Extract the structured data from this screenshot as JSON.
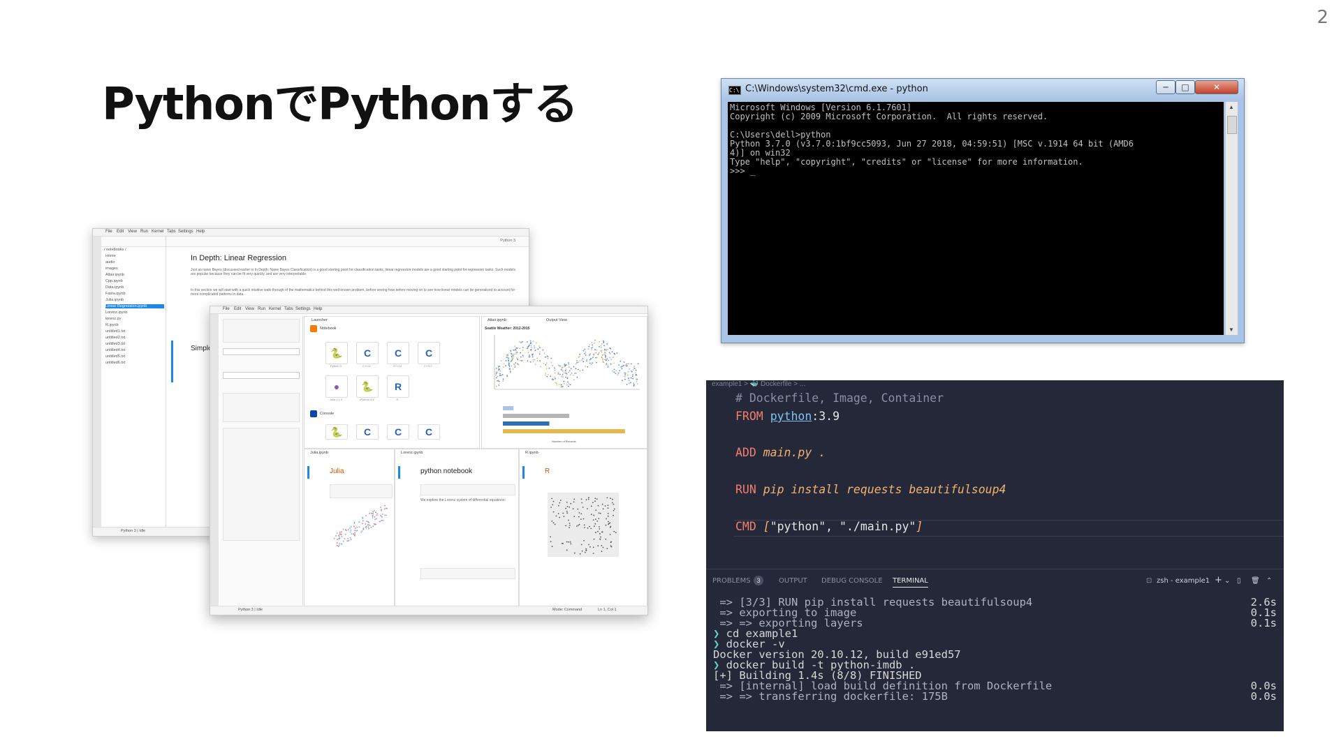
{
  "slide": {
    "page_number": "2",
    "title": "PythonでPythonする"
  },
  "cmd_window": {
    "title": "C:\\Windows\\system32\\cmd.exe - python",
    "icon": "cmd-icon",
    "buttons": [
      "─",
      "□",
      "✕"
    ],
    "lines": [
      "Microsoft Windows [Version 6.1.7601]",
      "Copyright (c) 2009 Microsoft Corporation.  All rights reserved.",
      "",
      "C:\\Users\\dell>python",
      "Python 3.7.0 (v3.7.0:1bf9cc5093, Jun 27 2018, 04:59:51) [MSC v.1914 64 bit (AMD6",
      "4)] on win32",
      "Type \"help\", \"copyright\", \"credits\" or \"license\" for more information.",
      ">>> _"
    ]
  },
  "jupyter_back": {
    "menu": [
      "File",
      "Edit",
      "View",
      "Run",
      "Kernel",
      "Tabs",
      "Settings",
      "Help"
    ],
    "path": "/ notebooks /",
    "files": [
      "Home",
      "audio",
      "images",
      "Altair.ipynb",
      "Cpp.ipynb",
      "Data.ipynb",
      "Fasta.ipynb",
      "Julia.ipynb",
      "Linear Regression.ipynb",
      "Lorenz.ipynb",
      "lorenz.py",
      "R.ipynb",
      "untitled1.txt",
      "untitled2.txt",
      "untitled3.txt",
      "untitled4.txt",
      "untitled5.txt",
      "untitled6.txt"
    ],
    "kernel": "Python 3",
    "heading": "In Depth: Linear Regression",
    "paragraph1": "Just as naive Bayes (discussed earlier in In Depth: Naive Bayes Classification) is a good starting point for classification tasks, linear regression models are a good starting point for regression tasks. Such models are popular because they can be fit very quickly, and are very interpretable.",
    "paragraph2": "In this section we will start with a quick intuitive walk-through of the mathematics behind this well-known problem, before seeing how before moving on to see how linear models can be generalized to account for more complicated patterns in data.",
    "subheading": "Simple",
    "status": "Python 3 | Idle"
  },
  "jupyter_front": {
    "menu": [
      "File",
      "Edit",
      "View",
      "Run",
      "Kernel",
      "Tabs",
      "Settings",
      "Help"
    ],
    "launcher_tab": "Launcher",
    "notebook_label": "Notebook",
    "console_label": "Console",
    "kernels": [
      {
        "glyph": "🐍",
        "label": "Python 3",
        "color": "#3572a5"
      },
      {
        "glyph": "C",
        "label": "C++11",
        "color": "#2b5fb3"
      },
      {
        "glyph": "C",
        "label": "C++14",
        "color": "#2b5fb3"
      },
      {
        "glyph": "C",
        "label": "C++17",
        "color": "#2b5fb3"
      },
      {
        "glyph": "●",
        "label": "Julia 1.1.0",
        "color": "#9558b2"
      },
      {
        "glyph": "🐍",
        "label": "xPython 3.6",
        "color": "#3572a5"
      },
      {
        "glyph": "R",
        "label": "R",
        "color": "#2165b6"
      }
    ],
    "altair_tab": "Altair.ipynb",
    "output_tab": "Output View",
    "chart_title": "Seattle Weather: 2012-2015",
    "bar_axis_label": "Number of Records",
    "bar_colors": [
      "#a9c4e8",
      "#b5b5b5",
      "#2e6fb3",
      "#e6b94a"
    ],
    "bar_values": [
      0.08,
      0.5,
      0.35,
      0.92
    ],
    "julia_tab": "Julia.ipynb",
    "lorenz_tab": "Lorenz.ipynb",
    "r_tab": "R.ipynb",
    "julia_heading": "Julia",
    "python_heading": "python notebook",
    "r_heading": "R",
    "lorenz_text": "We explore the Lorenz system of differential equations:",
    "status": "Python 3 | Idle",
    "mode": "Mode: Command",
    "cursor": "Ln 1, Col 1"
  },
  "vscode": {
    "breadcrumb": "example1 > 🐳 Dockerfile > ...",
    "editor": {
      "comment": "# Dockerfile, Image, Container",
      "from_kw": "FROM",
      "from_image": "python",
      "from_tag": ":3.9",
      "add_kw": "ADD",
      "add_args": "main.py .",
      "run_kw": "RUN",
      "run_args": "pip install requests beautifulsoup4",
      "cmd_kw": "CMD",
      "cmd_open": "[",
      "cmd_arg1": "\"python\"",
      "cmd_sep": ", ",
      "cmd_arg2": "\"./main.py\"",
      "cmd_close": "]"
    },
    "panel_tabs": {
      "problems": "PROBLEMS",
      "problems_count": "3",
      "output": "OUTPUT",
      "debug": "DEBUG CONSOLE",
      "terminal": "TERMINAL",
      "shell": "zsh - example1"
    },
    "terminal": [
      {
        "text": " => [3/3] RUN pip install requests beautifulsoup4",
        "time": "2.6s"
      },
      {
        "text": " => exporting to image",
        "time": "0.1s"
      },
      {
        "text": " => => exporting layers",
        "time": "0.1s"
      },
      {
        "prompt": "❯",
        "text": " cd example1",
        "time": ""
      },
      {
        "prompt": "❯",
        "text": " docker -v",
        "time": ""
      },
      {
        "text": "Docker version 20.10.12, build e91ed57",
        "time": ""
      },
      {
        "prompt": "❯",
        "text": " docker build -t python-imdb .",
        "time": ""
      },
      {
        "text": "[+] Building 1.4s (8/8) FINISHED",
        "time": ""
      },
      {
        "text": " => [internal] load build definition from Dockerfile",
        "time": "0.0s"
      },
      {
        "text": " => => transferring dockerfile: 175B",
        "time": "0.0s"
      }
    ]
  }
}
